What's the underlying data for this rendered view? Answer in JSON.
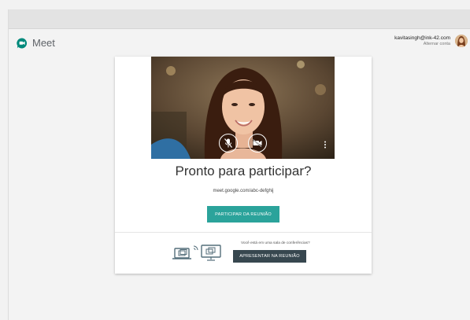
{
  "app": {
    "name": "Meet",
    "brand_color": "#00897b"
  },
  "account": {
    "email": "kavitasingh@ink-42.com",
    "switch_label": "Alternar conta"
  },
  "lobby": {
    "title": "Pronto para participar?",
    "meeting_url": "meet.google.com/abc-defghij",
    "join_label": "PARTICIPAR DA REUNIÃO",
    "join_color": "#2ba39b"
  },
  "room": {
    "question": "Você está em uma sala de conferências?",
    "present_label": "APRESENTAR NA REUNIÃO",
    "present_color": "#37474f"
  },
  "controls": {
    "mic_icon": "mic-off-icon",
    "camera_icon": "camera-off-icon",
    "more_icon": "more-vert-icon"
  }
}
